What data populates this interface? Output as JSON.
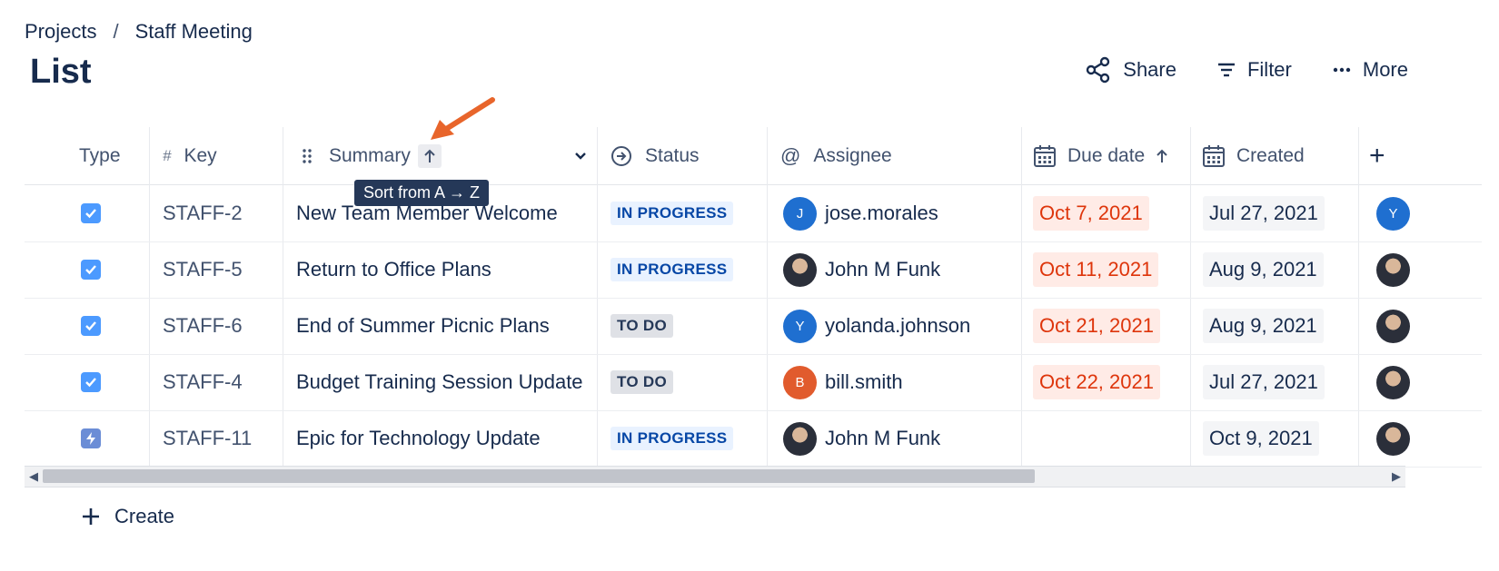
{
  "breadcrumb": {
    "parent": "Projects",
    "separator": "/",
    "current": "Staff Meeting"
  },
  "page_title": "List",
  "toolbar": {
    "share_label": "Share",
    "filter_label": "Filter",
    "more_label": "More"
  },
  "table": {
    "headers": {
      "type": "Type",
      "key_symbol": "#",
      "key": "Key",
      "summary": "Summary",
      "status": "Status",
      "assignee": "Assignee",
      "due_date": "Due date",
      "created": "Created",
      "add": "+"
    },
    "tooltip": "Sort from A → Z",
    "rows": [
      {
        "type": "task",
        "key": "STAFF-2",
        "summary": "New Team Member Welcome",
        "status": "IN PROGRESS",
        "assignee": "jose.morales",
        "avatar_initial": "J",
        "avatar_color": "#1f6fd0",
        "due": "Oct 7, 2021",
        "created": "Jul 27, 2021",
        "right_initial": "Y"
      },
      {
        "type": "task",
        "key": "STAFF-5",
        "summary": "Return to Office Plans",
        "status": "IN PROGRESS",
        "assignee": "John M Funk",
        "avatar_initial": "",
        "avatar_color": "photo",
        "due": "Oct 11, 2021",
        "created": "Aug 9, 2021",
        "right_initial": ""
      },
      {
        "type": "task",
        "key": "STAFF-6",
        "summary": "End of Summer Picnic Plans",
        "status": "TO DO",
        "assignee": "yolanda.johnson",
        "avatar_initial": "Y",
        "avatar_color": "#1f6fd0",
        "due": "Oct 21, 2021",
        "created": "Aug 9, 2021",
        "right_initial": ""
      },
      {
        "type": "task",
        "key": "STAFF-4",
        "summary": "Budget Training Session Update",
        "status": "TO DO",
        "assignee": "bill.smith",
        "avatar_initial": "B",
        "avatar_color": "#e15b2d",
        "due": "Oct 22, 2021",
        "created": "Jul 27, 2021",
        "right_initial": ""
      },
      {
        "type": "epic",
        "key": "STAFF-11",
        "summary": "Epic for Technology Update",
        "status": "IN PROGRESS",
        "assignee": "John M Funk",
        "avatar_initial": "",
        "avatar_color": "photo",
        "due": "",
        "created": "Oct 9, 2021",
        "right_initial": ""
      }
    ]
  },
  "create_label": "Create",
  "colors": {
    "accent": "#0052cc",
    "overdue": "#de350b",
    "annotation_arrow": "#e8652b"
  }
}
